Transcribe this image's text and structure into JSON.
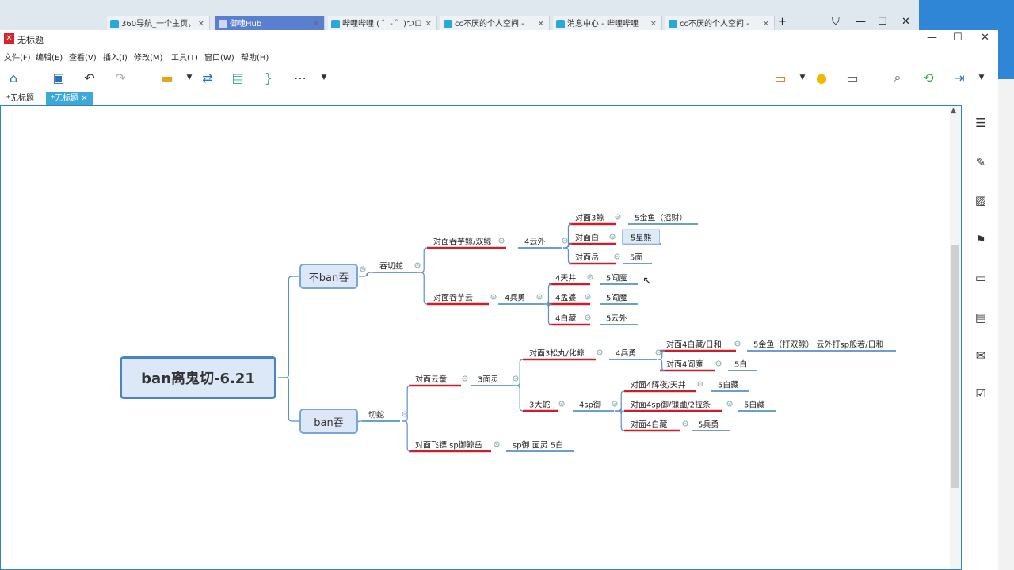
{
  "browser": {
    "tabs": [
      {
        "label": "360导航_一个主页，"
      },
      {
        "label": "御魂Hub"
      },
      {
        "label": "哔哩哔哩 ( ゜- ゜)つロ"
      },
      {
        "label": "cc不厌的个人空间 -"
      },
      {
        "label": "消息中心 - 哔哩哔哩"
      },
      {
        "label": "cc不厌的个人空间 -"
      }
    ],
    "new_tab": "+"
  },
  "window": {
    "title": "无标题",
    "min": "—",
    "max": "☐",
    "close": "✕"
  },
  "menu": [
    "文件(F)",
    "编辑(E)",
    "查看(V)",
    "插入(I)",
    "修改(M)",
    "工具(T)",
    "窗口(W)",
    "帮助(H)"
  ],
  "doc_tabs": [
    {
      "label": "*无标题"
    },
    {
      "label": "*无标题"
    }
  ],
  "doc_tab_close": "✕",
  "mindmap": {
    "root": "ban离鬼切-6.21",
    "branch_noban": "不ban吞",
    "branch_ban": "ban吞",
    "n_tuntiesha": "吞切蛇",
    "n_qiesha": "切蛇",
    "n_tunzijing": "对面吞芋鲸/双鲸",
    "n_4yunwai": "4云外",
    "n_3jing": "对面3鲸",
    "n_5jinyu_zc": "5金鱼（招财）",
    "n_duimianbai": "对面白",
    "n_5xingxiong": "5星熊",
    "n_duimianyue": "对面岳",
    "n_5mian": "5面",
    "n_tunziyun": "对面吞芋云",
    "n_4bingyong": "4兵勇",
    "n_4tianjing": "4天井",
    "n_5yanmo_a": "5阎魔",
    "n_4mengpo": "4孟婆",
    "n_5yanmo_b": "5阎魔",
    "n_4baizang": "4白藏",
    "n_5yunwai": "5云外",
    "n_yuntong": "对面云童",
    "n_3mianling": "3面灵",
    "n_songwan": "对面3松丸/化鲸",
    "n_4bingyong_b": "4兵勇",
    "n_d4baizang_rihe": "对面4白藏/日和",
    "n_5jinyu_long": "5金鱼（打双鲸） 云外打sp般若/日和",
    "n_d4yanmo": "对面4阎魔",
    "n_5bai": "5白",
    "n_3dashe": "3大蛇",
    "n_4spyu": "4sp御",
    "n_d4huiye": "对面4辉夜/天井",
    "n_5baizang_a": "5白藏",
    "n_d4spyu": "对面4sp御/镰鼬/2拉条",
    "n_5baizang_b": "5白藏",
    "n_d4baizang": "对面4白藏",
    "n_5bingyong": "5兵勇",
    "n_feibiao": "对面飞镖 sp御鲸岳",
    "n_spyu_ml": "sp御 面灵 5白"
  },
  "colors": {
    "accent_red": "#c8202a",
    "accent_blue": "#4a83c3",
    "line": "#5a8fc8"
  }
}
